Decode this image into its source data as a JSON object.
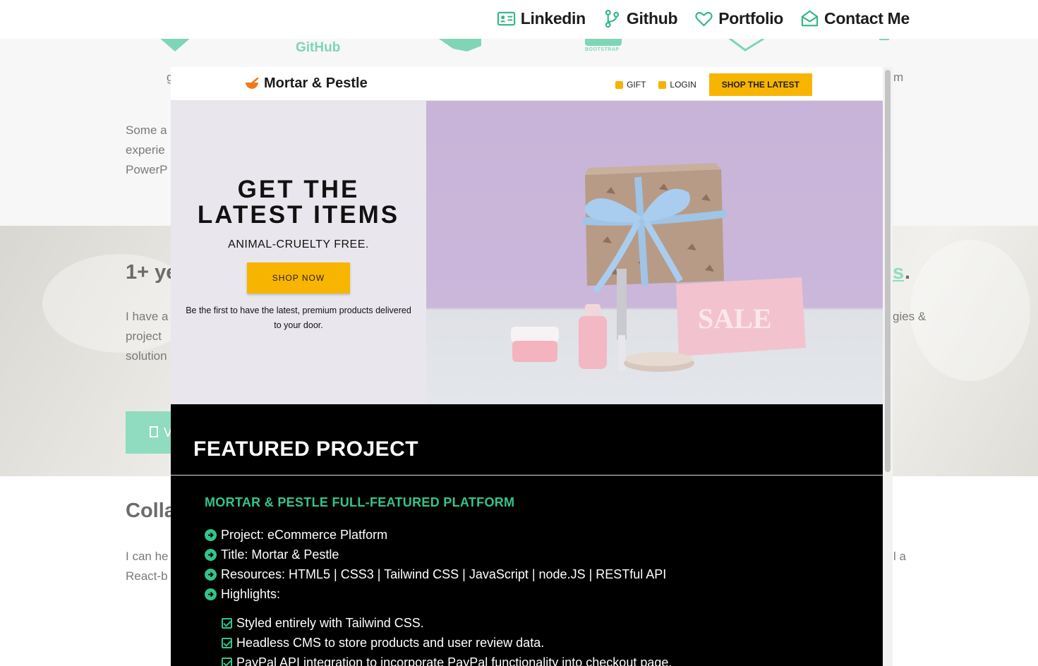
{
  "nav": {
    "links": [
      {
        "label": "Linkedin",
        "icon": "id-card-icon"
      },
      {
        "label": "Github",
        "icon": "git-branch-icon"
      },
      {
        "label": "Portfolio",
        "icon": "heart-icon"
      },
      {
        "label": "Contact Me",
        "icon": "envelope-open-icon"
      }
    ]
  },
  "background": {
    "logo_github": "GitHub",
    "logo_bootstrap": "BOOTSTRAP",
    "frag_g": "g",
    "frag_m": "m",
    "para1": [
      "Some a",
      "experie",
      "PowerP"
    ],
    "heading1_left": "1+ ye",
    "heading1_right": "s",
    "heading1_period": ".",
    "para2": [
      "I have a",
      "project",
      "solution"
    ],
    "para2_right": "gies &",
    "button_frag": "V",
    "heading2": "Colla",
    "para3": [
      "I can he",
      "React-b"
    ],
    "para3_right": "l a"
  },
  "modal": {
    "shot": {
      "brand": "Mortar & Pestle",
      "link_gift": "GIFT",
      "link_login": "LOGIN",
      "shop_latest": "SHOP THE LATEST",
      "hero_title_line1": "GET THE",
      "hero_title_line2": "LATEST ITEMS",
      "hero_sub": "ANIMAL-CRUELTY FREE.",
      "shop_now": "SHOP NOW",
      "hero_desc": "Be the first to have the latest, premium products delivered to your door.",
      "sale_text": "SALE"
    },
    "featured_heading": "FEATURED PROJECT",
    "project_title": "MORTAR & PESTLE FULL-FEATURED PLATFORM",
    "info": [
      "Project: eCommerce Platform",
      "Title: Mortar & Pestle",
      "Resources: HTML5 | CSS3 | Tailwind CSS | JavaScript | node.JS | RESTful API",
      "Highlights:"
    ],
    "highlights": [
      "Styled entirely with Tailwind CSS.",
      "Headless CMS to store products and user review data.",
      "PayPal API integration to incorporate PayPal functionality into checkout page."
    ],
    "colors": {
      "accent": "#33c48b",
      "cta": "#f7b500"
    }
  }
}
